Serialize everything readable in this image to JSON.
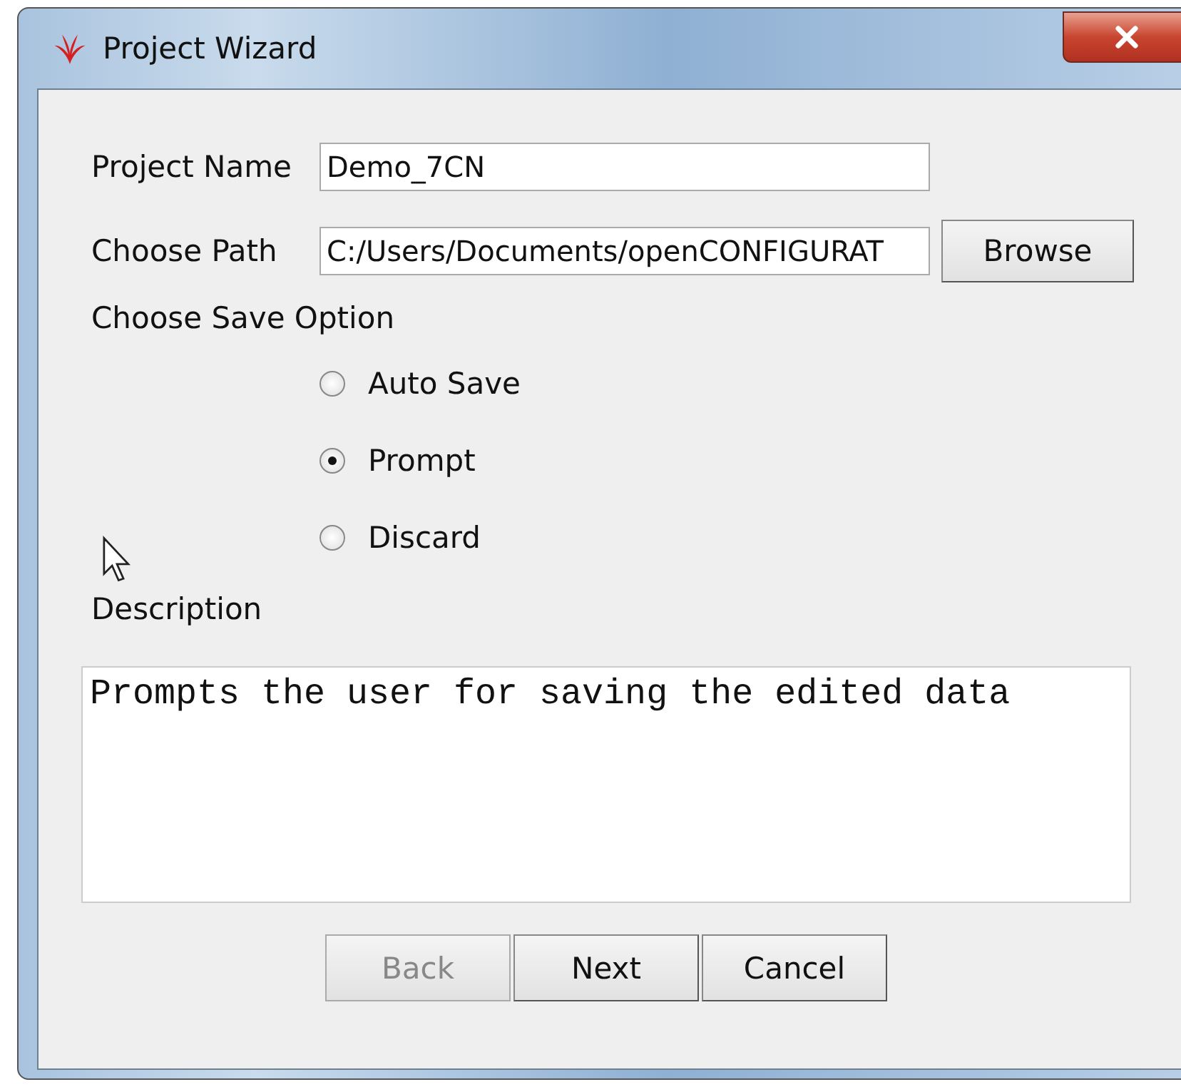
{
  "window": {
    "title": "Project Wizard"
  },
  "fields": [
    {
      "label": "Project Name",
      "value": "Demo_7CN"
    },
    {
      "label": "Choose Path",
      "value": "C:/Users/Documents/openCONFIGURAT",
      "button": "Browse"
    }
  ],
  "save_option": {
    "label": "Choose Save Option",
    "options": [
      {
        "label": "Auto Save",
        "selected": false
      },
      {
        "label": "Prompt",
        "selected": true
      },
      {
        "label": "Discard",
        "selected": false
      }
    ]
  },
  "description": {
    "label": "Description",
    "value": "Prompts the user for saving the edited data"
  },
  "buttons": [
    {
      "label": "Back",
      "disabled": true
    },
    {
      "label": "Next",
      "disabled": false
    },
    {
      "label": "Cancel",
      "disabled": false
    }
  ]
}
